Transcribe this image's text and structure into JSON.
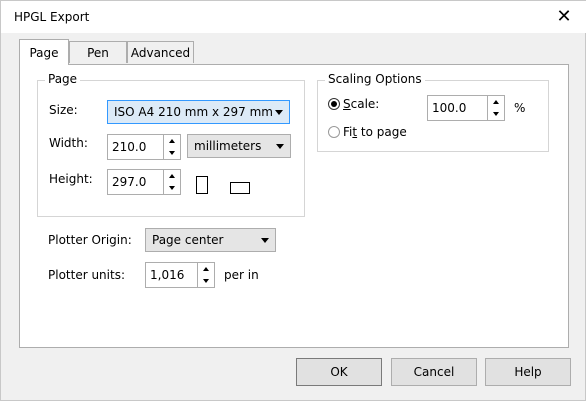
{
  "window": {
    "title": "HPGL Export"
  },
  "tabs": [
    {
      "label": "Page",
      "active": true
    },
    {
      "label": "Pen",
      "active": false
    },
    {
      "label": "Advanced",
      "active": false
    }
  ],
  "page_group": {
    "legend": "Page",
    "size_label": "Size:",
    "size_value": "ISO A4 210 mm x 297 mm",
    "width_label": "Width:",
    "width_value": "210.0",
    "units_value": "millimeters",
    "height_label": "Height:",
    "height_value": "297.0"
  },
  "scaling_group": {
    "legend": "Scaling Options",
    "scale_first": "S",
    "scale_rest": "cale:",
    "scale_selected": true,
    "scale_value": "100.0",
    "scale_unit": "%",
    "fit_first": "Fi",
    "fit_ul": "t",
    "fit_rest": " to page",
    "fit_selected": false
  },
  "plotter": {
    "origin_label": "Plotter Origin:",
    "origin_value": "Page center",
    "units_label": "Plotter units:",
    "units_value": "1,016",
    "units_suffix": "per in"
  },
  "buttons": {
    "ok": "OK",
    "cancel": "Cancel",
    "help": "Help"
  }
}
